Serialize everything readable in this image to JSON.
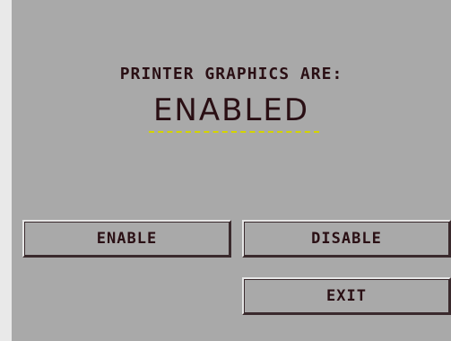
{
  "header": {
    "title": "PRINTER GRAPHICS ARE:"
  },
  "status": {
    "value": "ENABLED"
  },
  "buttons": {
    "enable": "ENABLE",
    "disable": "DISABLE",
    "exit": "EXIT"
  },
  "colors": {
    "background": "#a9a9a9",
    "text": "#2a0f14",
    "underline": "#d4d400",
    "outer": "#e9e9e9"
  }
}
